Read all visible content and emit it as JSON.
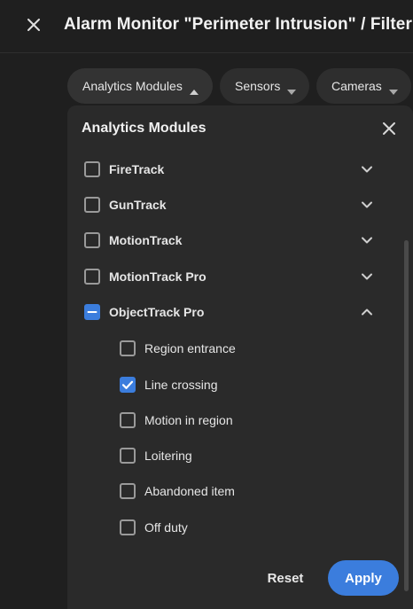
{
  "header": {
    "title": "Alarm Monitor \"Perimeter Intrusion\" / Filter",
    "close_icon": "close-icon"
  },
  "chips": [
    {
      "label": "Analytics Modules",
      "state": "expanded"
    },
    {
      "label": "Sensors",
      "state": "collapsed"
    },
    {
      "label": "Cameras",
      "state": "collapsed"
    }
  ],
  "panel": {
    "title": "Analytics Modules",
    "modules": [
      {
        "label": "FireTrack",
        "state": "unchecked",
        "expanded": false
      },
      {
        "label": "GunTrack",
        "state": "unchecked",
        "expanded": false
      },
      {
        "label": "MotionTrack",
        "state": "unchecked",
        "expanded": false
      },
      {
        "label": "MotionTrack Pro",
        "state": "unchecked",
        "expanded": false
      },
      {
        "label": "ObjectTrack Pro",
        "state": "indeterminate",
        "expanded": true
      }
    ],
    "sub_items": [
      {
        "label": "Region entrance",
        "checked": false
      },
      {
        "label": "Line crossing",
        "checked": true
      },
      {
        "label": "Motion in region",
        "checked": false
      },
      {
        "label": "Loitering",
        "checked": false
      },
      {
        "label": "Abandoned item",
        "checked": false
      },
      {
        "label": "Off duty",
        "checked": false
      }
    ],
    "reset_label": "Reset",
    "apply_label": "Apply"
  },
  "colors": {
    "accent": "#3b7ddd",
    "background": "#1f1f1f",
    "panel": "#2a2a2a",
    "chip": "#2e2e2e"
  }
}
